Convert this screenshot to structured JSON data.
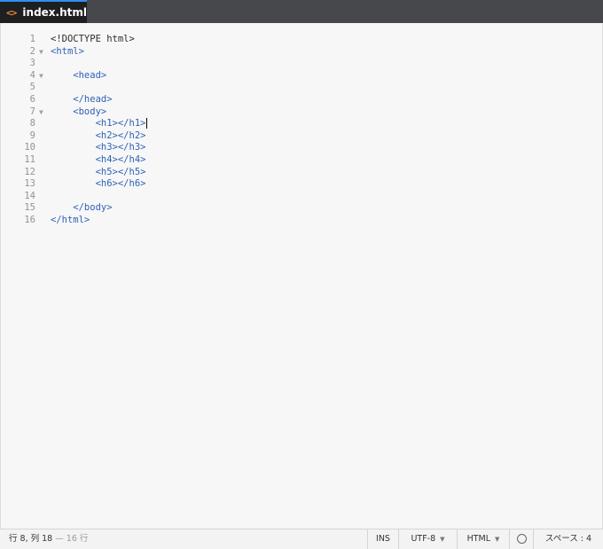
{
  "tab": {
    "icon": "code-icon",
    "icon_glyph": "<>",
    "label": "index.html"
  },
  "editor": {
    "lines": [
      {
        "num": "1",
        "text": "<!DOCTYPE html>",
        "fold": ""
      },
      {
        "num": "2",
        "text": "<html>",
        "fold": "▼"
      },
      {
        "num": "3",
        "text": "",
        "fold": ""
      },
      {
        "num": "4",
        "text": "    <head>",
        "fold": "▼"
      },
      {
        "num": "5",
        "text": "",
        "fold": ""
      },
      {
        "num": "6",
        "text": "    </head>",
        "fold": ""
      },
      {
        "num": "7",
        "text": "    <body>",
        "fold": "▼"
      },
      {
        "num": "8",
        "text": "        <h1></h1>",
        "fold": ""
      },
      {
        "num": "9",
        "text": "        <h2></h2>",
        "fold": ""
      },
      {
        "num": "10",
        "text": "        <h3></h3>",
        "fold": ""
      },
      {
        "num": "11",
        "text": "        <h4></h4>",
        "fold": ""
      },
      {
        "num": "12",
        "text": "        <h5></h5>",
        "fold": ""
      },
      {
        "num": "13",
        "text": "        <h6></h6>",
        "fold": ""
      },
      {
        "num": "14",
        "text": "",
        "fold": ""
      },
      {
        "num": "15",
        "text": "    </body>",
        "fold": ""
      },
      {
        "num": "16",
        "text": "</html>",
        "fold": ""
      }
    ],
    "cursor_line": 8,
    "tag_color": "#2f61b7",
    "doctype_color": "#2d2d2d"
  },
  "status": {
    "position": "行 8, 列 18",
    "total": "— 16 行",
    "mode": "INS",
    "encoding": "UTF-8",
    "language": "HTML",
    "lint_icon": "circle-icon",
    "indent": "スペース : 4"
  }
}
